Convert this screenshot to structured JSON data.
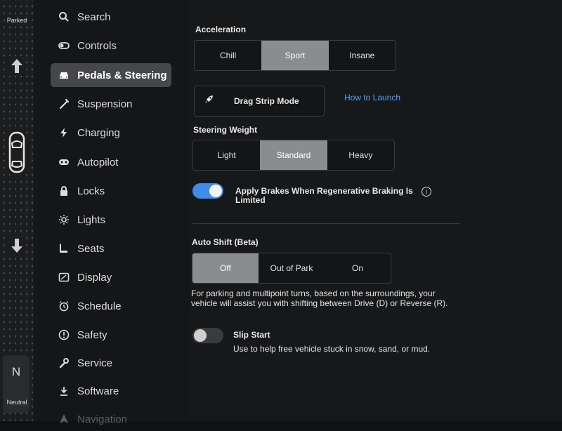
{
  "gear": {
    "parked": "Parked",
    "current": "N",
    "neutral": "Neutral"
  },
  "nav": {
    "items": [
      {
        "label": "Search",
        "icon": "search-icon"
      },
      {
        "label": "Controls",
        "icon": "toggle-icon"
      },
      {
        "label": "Pedals & Steering",
        "icon": "car-icon",
        "active": true
      },
      {
        "label": "Suspension",
        "icon": "wrench-pen-icon"
      },
      {
        "label": "Charging",
        "icon": "bolt-icon"
      },
      {
        "label": "Autopilot",
        "icon": "steering-wheel-icon"
      },
      {
        "label": "Locks",
        "icon": "lock-icon"
      },
      {
        "label": "Lights",
        "icon": "sun-icon"
      },
      {
        "label": "Seats",
        "icon": "seat-icon"
      },
      {
        "label": "Display",
        "icon": "display-icon"
      },
      {
        "label": "Schedule",
        "icon": "alarm-clock-icon"
      },
      {
        "label": "Safety",
        "icon": "alert-circle-icon"
      },
      {
        "label": "Service",
        "icon": "wrench-icon"
      },
      {
        "label": "Software",
        "icon": "download-icon"
      },
      {
        "label": "Navigation",
        "icon": "navigation-icon"
      }
    ]
  },
  "acceleration": {
    "title": "Acceleration",
    "options": [
      "Chill",
      "Sport",
      "Insane"
    ],
    "selected": "Sport"
  },
  "drag_strip": {
    "label": "Drag Strip Mode",
    "link": "How to Launch"
  },
  "steering": {
    "title": "Steering Weight",
    "options": [
      "Light",
      "Standard",
      "Heavy"
    ],
    "selected": "Standard"
  },
  "regen": {
    "label": "Apply Brakes When Regenerative Braking Is Limited",
    "enabled": true,
    "info": "i"
  },
  "auto_shift": {
    "title": "Auto Shift (Beta)",
    "options": [
      "Off",
      "Out of Park",
      "On"
    ],
    "selected": "Off",
    "description": "For parking and multipoint turns, based on the surroundings, your vehicle will assist you with shifting between Drive (D) or Reverse (R)."
  },
  "slip_start": {
    "title": "Slip Start",
    "description": "Use to help free vehicle stuck in snow, sand, or mud.",
    "enabled": false
  },
  "colors": {
    "accent": "#3e8de8",
    "link": "#4ea3ff",
    "selected_segment": "#8a8c90"
  }
}
